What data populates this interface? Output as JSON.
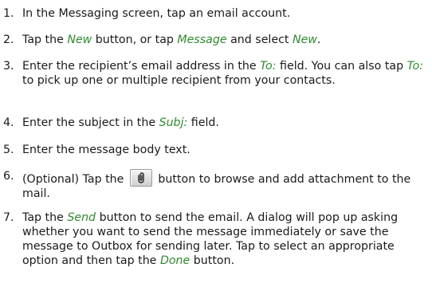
{
  "steps": [
    {
      "number": "1.",
      "parts": [
        {
          "text": "In the Messaging screen, tap an email account."
        }
      ]
    },
    {
      "number": "2.",
      "parts": [
        {
          "text": "Tap the "
        },
        {
          "text": "New",
          "em": true
        },
        {
          "text": " button, or tap "
        },
        {
          "text": "Message",
          "em": true
        },
        {
          "text": " and select "
        },
        {
          "text": "New",
          "em": true
        },
        {
          "text": "."
        }
      ]
    },
    {
      "number": "3.",
      "parts": [
        {
          "text": "Enter the recipient’s email address in the "
        },
        {
          "text": "To:",
          "em": true
        },
        {
          "text": " field. You can also tap "
        },
        {
          "text": "To:",
          "em": true
        },
        {
          "text": " to pick up one or multiple recipient from your contacts."
        }
      ]
    },
    {
      "number": "4.",
      "parts": [
        {
          "text": "Enter the subject in the "
        },
        {
          "text": "Subj:",
          "em": true
        },
        {
          "text": " field."
        }
      ]
    },
    {
      "number": "5.",
      "parts": [
        {
          "text": "Enter the message body text."
        }
      ]
    },
    {
      "number": "6.",
      "parts": [
        {
          "text": "(Optional) Tap the "
        },
        {
          "icon": "paperclip-icon"
        },
        {
          "text": " button to browse and add attachment to the mail."
        }
      ]
    },
    {
      "number": "7.",
      "parts": [
        {
          "text": "Tap the "
        },
        {
          "text": "Send",
          "em": true
        },
        {
          "text": " button to send the email. A dialog will pop up asking whether you want to send the message immediately or save the message to Outbox for sending later. Tap to select an appropriate option and then tap the "
        },
        {
          "text": "Done",
          "em": true
        },
        {
          "text": " button."
        }
      ]
    }
  ],
  "colors": {
    "emphasis": "#2e8b2e",
    "text": "#1a1a1a"
  }
}
